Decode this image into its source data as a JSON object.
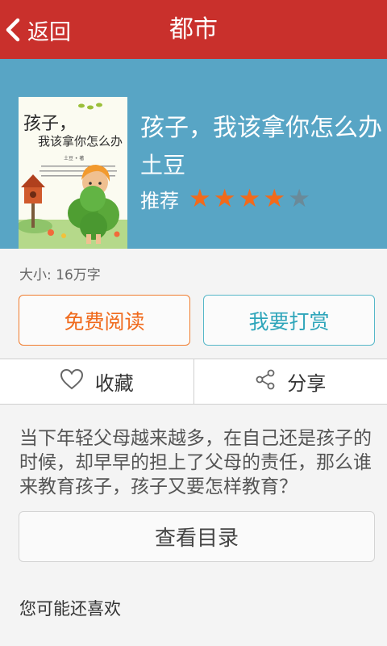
{
  "header": {
    "back_label": "返回",
    "title": "都市"
  },
  "book": {
    "cover": {
      "title_line1": "孩子，",
      "title_line2": "我该拿你怎么办",
      "author_mark": "土豆 • 著"
    },
    "title": "孩子，我该拿你怎么办",
    "author": "土豆",
    "recommend_label": "推荐",
    "rating": {
      "value": 4,
      "max": 5
    },
    "size_text": "大小: 16万字"
  },
  "buttons": {
    "read": "免费阅读",
    "reward": "我要打赏",
    "favorite": "收藏",
    "share": "分享",
    "toc": "查看目录"
  },
  "description": "当下年轻父母越来越多，在自己还是孩子的时候，却早早的担上了父母的责任，那么谁来教育孩子，孩子又要怎样教育？",
  "section": {
    "may_like": "您可能还喜欢"
  },
  "colors": {
    "header_bg": "#c9302c",
    "hero_bg": "#58a5c5",
    "read_accent": "#f06a1c",
    "reward_accent": "#2ea5ba",
    "star_on": "#f26a1b"
  },
  "icons": [
    "back-chevron-icon",
    "heart-icon",
    "share-icon",
    "star-icon"
  ]
}
